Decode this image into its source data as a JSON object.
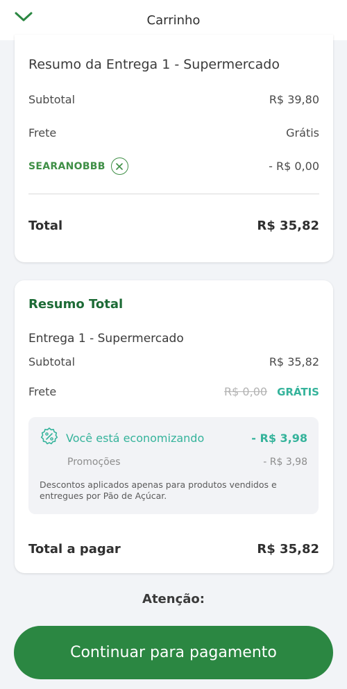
{
  "header": {
    "title": "Carrinho"
  },
  "delivery": {
    "title": "Resumo da Entrega 1 - Supermercado",
    "subtotal_label": "Subtotal",
    "subtotal_value": "R$ 39,80",
    "shipping_label": "Frete",
    "shipping_value": "Grátis",
    "coupon_code": "SEARANOBBB",
    "coupon_value": "- R$ 0,00",
    "total_label": "Total",
    "total_value": "R$ 35,82"
  },
  "summary": {
    "title": "Resumo Total",
    "delivery_name": "Entrega 1 - Supermercado",
    "subtotal_label": "Subtotal",
    "subtotal_value": "R$ 35,82",
    "shipping_label": "Frete",
    "shipping_old": "R$ 0,00",
    "shipping_free": "GRÁTIS",
    "savings_title": "Você está economizando",
    "savings_value": "- R$ 3,98",
    "promo_label": "Promoções",
    "promo_value": "- R$ 3,98",
    "note": "Descontos aplicados apenas para produtos vendidos e entregues por Pão de Açúcar.",
    "total_label": "Total a pagar",
    "total_value": "R$ 35,82"
  },
  "attention": "Atenção:",
  "cta_label": "Continuar para pagamento",
  "colors": {
    "brand_green": "#2b8742",
    "accent_teal": "#35b39b",
    "dark_green": "#1d6b36"
  }
}
